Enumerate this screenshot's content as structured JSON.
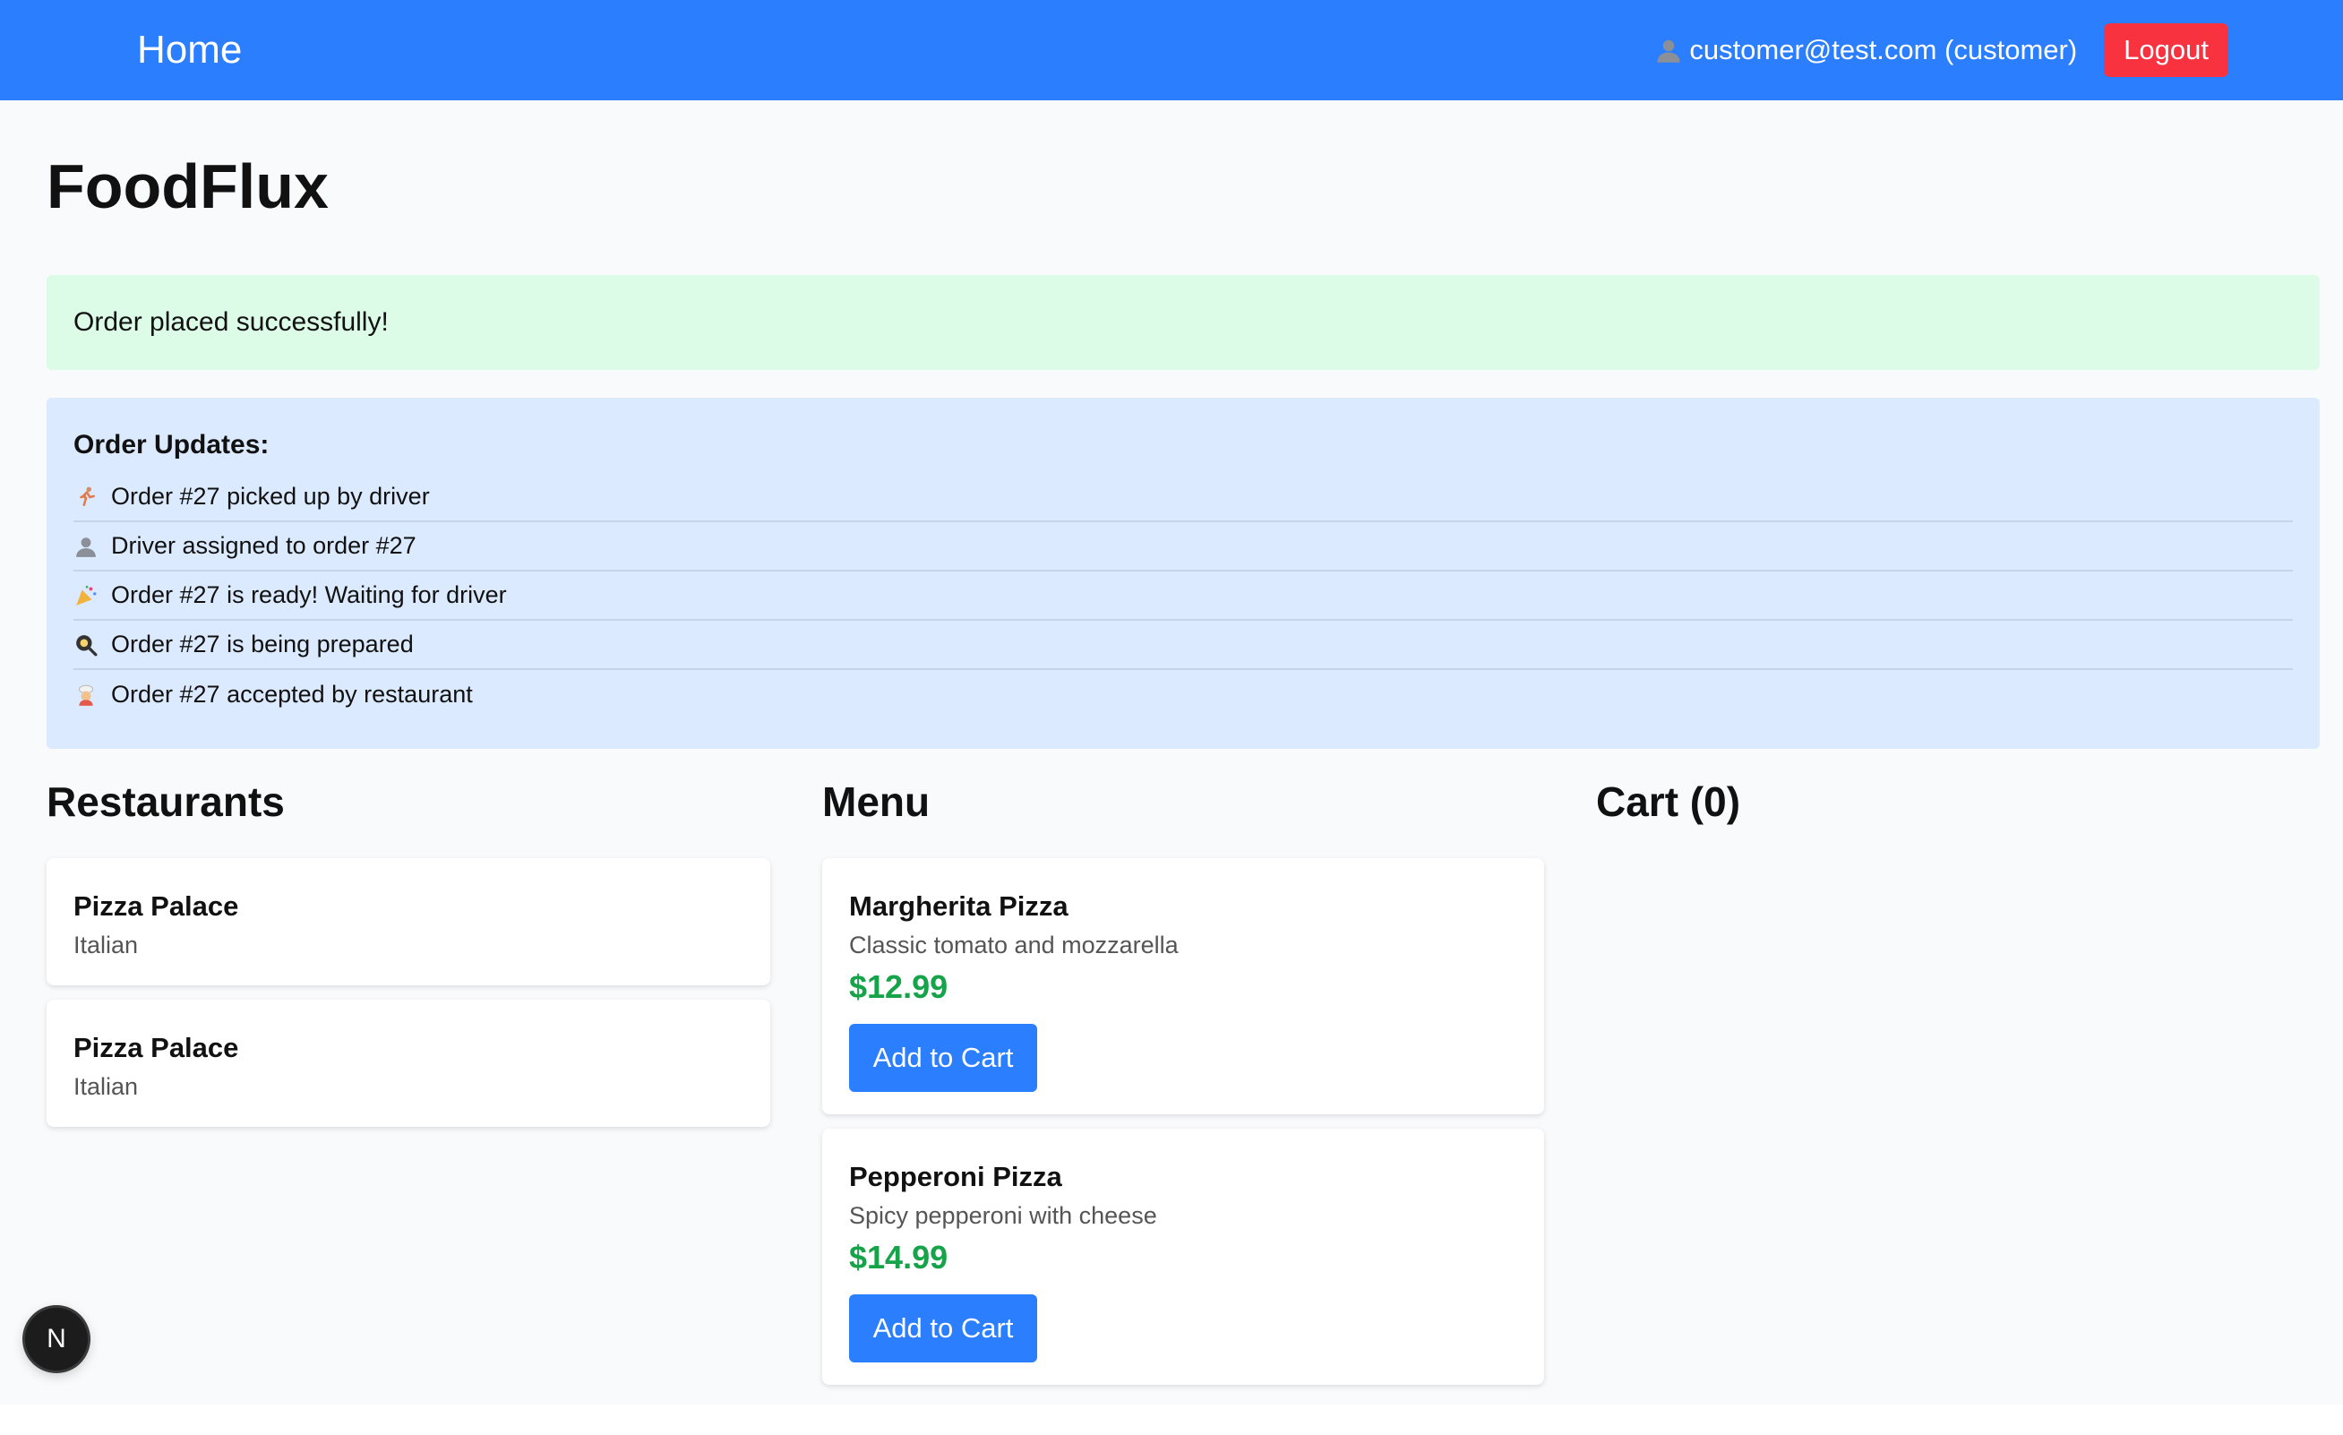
{
  "nav": {
    "home_label": "Home",
    "user_text": "customer@test.com (customer)",
    "user_icon": "user-icon",
    "logout_label": "Logout",
    "brand_color": "#2b7ffe",
    "logout_color": "#f8323f"
  },
  "page": {
    "title": "FoodFlux"
  },
  "alert": {
    "message": "Order placed successfully!"
  },
  "updates": {
    "title": "Order Updates:",
    "items": [
      {
        "icon": "running-person-icon",
        "text": "Order #27 picked up by driver"
      },
      {
        "icon": "person-icon",
        "text": "Driver assigned to order #27"
      },
      {
        "icon": "party-popper-icon",
        "text": "Order #27 is ready! Waiting for driver"
      },
      {
        "icon": "frying-pan-icon",
        "text": "Order #27 is being prepared"
      },
      {
        "icon": "cook-icon",
        "text": "Order #27 accepted by restaurant"
      }
    ]
  },
  "restaurants": {
    "title": "Restaurants",
    "items": [
      {
        "name": "Pizza Palace",
        "cuisine": "Italian"
      },
      {
        "name": "Pizza Palace",
        "cuisine": "Italian"
      }
    ]
  },
  "menu": {
    "title": "Menu",
    "items": [
      {
        "name": "Margherita Pizza",
        "description": "Classic tomato and mozzarella",
        "price": "$12.99",
        "button": "Add to Cart"
      },
      {
        "name": "Pepperoni Pizza",
        "description": "Spicy pepperoni with cheese",
        "price": "$14.99",
        "button": "Add to Cart"
      }
    ]
  },
  "cart": {
    "title": "Cart (0)"
  },
  "dev_badge": {
    "label": "N"
  }
}
